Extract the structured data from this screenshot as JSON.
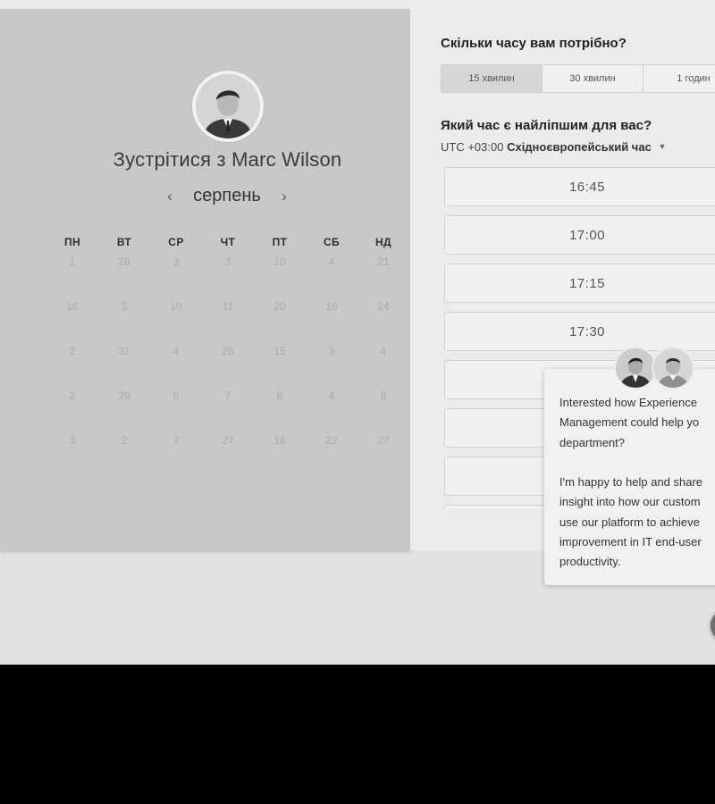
{
  "host": {
    "title_prefix": "Зустрітися з",
    "name": "Marc Wilson"
  },
  "calendar": {
    "month": "серпень",
    "weekdays": [
      "ПН",
      "ВТ",
      "СР",
      "ЧТ",
      "ПТ",
      "СБ",
      "НД"
    ],
    "rows": [
      [
        "1",
        "26",
        "3",
        "3",
        "10",
        "4",
        "21"
      ],
      [
        "16",
        "3",
        "10",
        "11",
        "20",
        "16",
        "24"
      ],
      [
        "2",
        "31",
        "4",
        "26",
        "15",
        "3",
        "4"
      ],
      [
        "2",
        "29",
        "6",
        "7",
        "8",
        "4",
        "8"
      ],
      [
        "3",
        "2",
        "7",
        "27",
        "16",
        "22",
        "27"
      ]
    ]
  },
  "booking": {
    "duration_question": "Скільки часу вам потрібно?",
    "durations": [
      "15 хвилин",
      "30 хвилин",
      "1 годин"
    ],
    "time_question": "Який час є найліпшим для вас?",
    "tz_offset": "UTC +03:00",
    "tz_name": "Східноєвропейський час",
    "slots": [
      "16:45",
      "17:00",
      "17:15",
      "17:30",
      "",
      "",
      ""
    ]
  },
  "chat": {
    "message": "Interested how Experience\nManagement could help yo\ndepartment?\n\nI'm happy to help and share\ninsight into how our custom\nuse our platform to achieve\nimprovement in IT end-user\nproductivity."
  },
  "colors": {
    "left_panel_bg": "#c8c8c8",
    "right_panel_bg": "#ebebeb",
    "footer_bg": "#000000"
  }
}
